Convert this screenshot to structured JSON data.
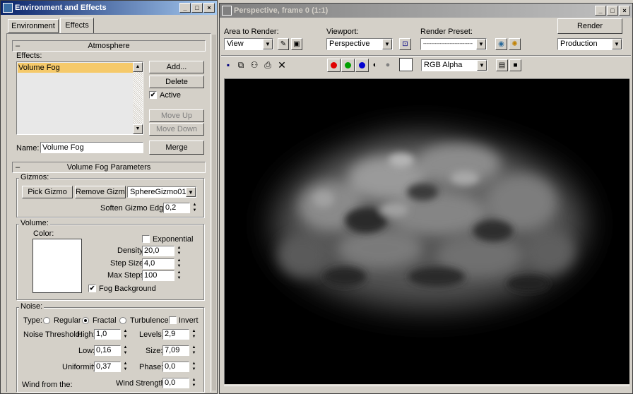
{
  "left_window": {
    "title": "Environment and Effects",
    "tabs": [
      {
        "label": "Environment"
      },
      {
        "label": "Effects"
      }
    ],
    "atmosphere": {
      "rollout_title": "Atmosphere",
      "effects_label": "Effects:",
      "effects_list": [
        "Volume Fog"
      ],
      "buttons": {
        "add": "Add...",
        "delete": "Delete",
        "move_up": "Move Up",
        "move_down": "Move Down",
        "merge": "Merge"
      },
      "active_label": "Active",
      "active_checked": true,
      "name_label": "Name:",
      "name_value": "Volume Fog"
    },
    "volume_fog": {
      "rollout_title": "Volume Fog Parameters",
      "gizmos": {
        "title": "Gizmos:",
        "pick_gizmo": "Pick Gizmo",
        "remove_gizmo": "Remove Gizmo",
        "gizmo_select": "SphereGizmo01",
        "soften_label": "Soften Gizmo Edges:",
        "soften_value": "0,2"
      },
      "volume": {
        "title": "Volume:",
        "color_label": "Color:",
        "color_value": "#ffffff",
        "exponential_label": "Exponential",
        "exponential_checked": false,
        "density_label": "Density:",
        "density_value": "20,0",
        "step_size_label": "Step Size:",
        "step_size_value": "4,0",
        "max_steps_label": "Max Steps:",
        "max_steps_value": "100",
        "fog_background_label": "Fog Background",
        "fog_background_checked": true
      },
      "noise": {
        "title": "Noise:",
        "type_label": "Type:",
        "types": [
          "Regular",
          "Fractal",
          "Turbulence"
        ],
        "selected_type": "Fractal",
        "invert_label": "Invert",
        "threshold_label": "Noise Threshold:",
        "high_label": "High:",
        "high_value": "1,0",
        "low_label": "Low:",
        "low_value": "0,16",
        "uniformity_label": "Uniformity:",
        "uniformity_value": "0,37",
        "levels_label": "Levels:",
        "levels_value": "2,9",
        "size_label": "Size:",
        "size_value": "7,09",
        "phase_label": "Phase:",
        "phase_value": "0,0",
        "wind_from_label": "Wind from the:",
        "wind_strength_label": "Wind Strength:",
        "wind_strength_value": "0,0"
      }
    }
  },
  "right_window": {
    "title": "Perspective, frame 0 (1:1)",
    "area_label": "Area to Render:",
    "area_value": "View",
    "viewport_label": "Viewport:",
    "viewport_value": "Perspective",
    "preset_label": "Render Preset:",
    "preset_value": "------------------------------",
    "render_button": "Render",
    "mode_value": "Production",
    "channel_value": "RGB Alpha",
    "colors": {
      "red": "#e00000",
      "green": "#00a000",
      "blue": "#0000d0"
    }
  }
}
